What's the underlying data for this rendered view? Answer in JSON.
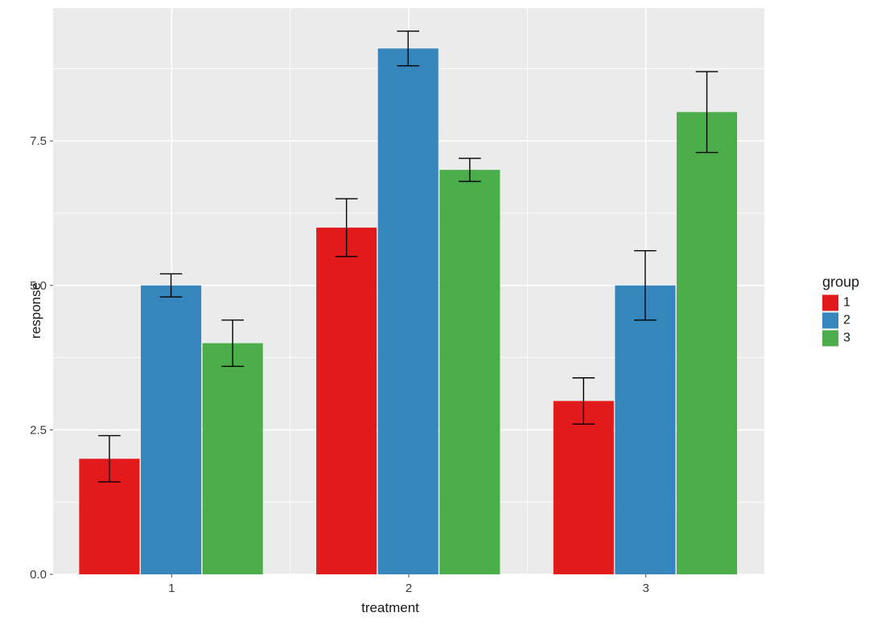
{
  "chart_data": {
    "type": "bar",
    "categories": [
      "1",
      "2",
      "3"
    ],
    "series": [
      {
        "name": "1",
        "values": [
          2.0,
          6.0,
          3.0
        ],
        "err": [
          0.4,
          0.5,
          0.4
        ],
        "color": "#e31a1c"
      },
      {
        "name": "2",
        "values": [
          5.0,
          9.1,
          5.0
        ],
        "err": [
          0.2,
          0.3,
          0.6
        ],
        "color": "#3586bd"
      },
      {
        "name": "3",
        "values": [
          4.0,
          7.0,
          8.0
        ],
        "err": [
          0.4,
          0.2,
          0.7
        ],
        "color": "#4bae4b"
      }
    ],
    "xlabel": "treatment",
    "ylabel": "response",
    "y_ticks": [
      0.0,
      2.5,
      5.0,
      7.5
    ],
    "ylim": [
      0.0,
      9.8
    ],
    "legend_title": "group",
    "panel_bg": "#ebebeb",
    "grid_major": "#ffffff",
    "plot_bg": "#ffffff",
    "tick_color": "#4d4d4d"
  }
}
